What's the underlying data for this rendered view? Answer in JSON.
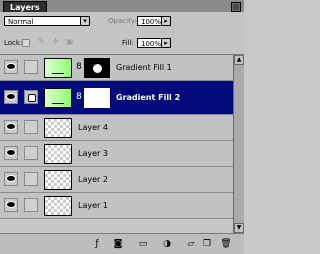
{
  "panel": {
    "tab_label": "Layers"
  },
  "controls": {
    "blend_mode": "Normal",
    "opacity_label": "Opacity:",
    "opacity_value": "100%",
    "lock_label": "Lock:",
    "fill_label": "Fill:",
    "fill_value": "100%"
  },
  "layers": [
    {
      "name": "Gradient Fill 1",
      "type": "gradient-fill",
      "mask": "black-circle",
      "selected": false
    },
    {
      "name": "Gradient Fill 2",
      "type": "gradient-fill",
      "mask": "white",
      "selected": true
    },
    {
      "name": "Layer 4",
      "type": "pixel",
      "selected": false
    },
    {
      "name": "Layer 3",
      "type": "pixel",
      "selected": false
    },
    {
      "name": "Layer 2",
      "type": "pixel",
      "selected": false
    },
    {
      "name": "Layer 1",
      "type": "pixel",
      "selected": false
    }
  ],
  "toolbar_icons": [
    "link-layers-icon",
    "layer-style-icon",
    "add-mask-icon",
    "new-group-icon",
    "new-adjustment-layer-icon",
    "new-layer-icon",
    "delete-layer-icon"
  ],
  "colors": {
    "selection": "#000a7a",
    "gradient_start": "#d8ffd0",
    "gradient_end": "#90ff70"
  }
}
